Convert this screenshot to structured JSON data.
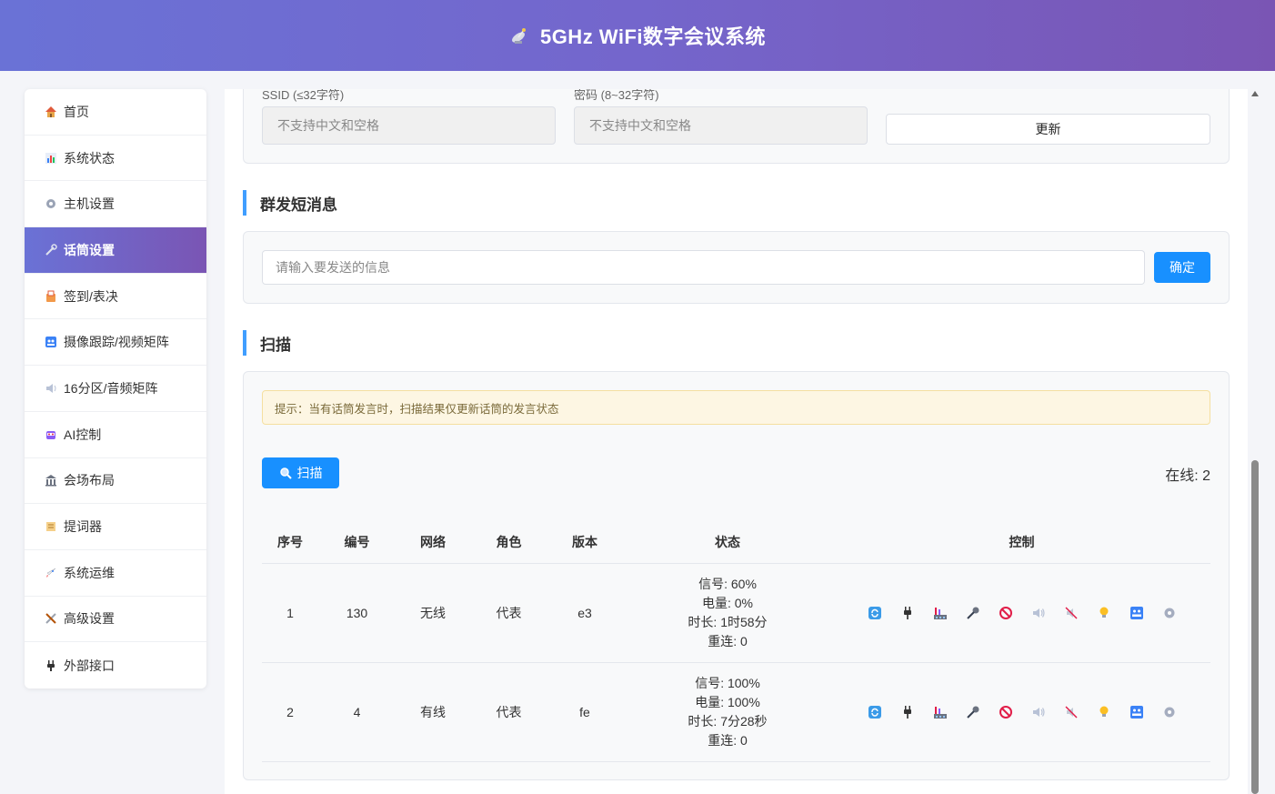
{
  "header": {
    "title": "5GHz WiFi数字会议系统",
    "logo_icon": "satellite-antenna-icon"
  },
  "sidebar": {
    "items": [
      {
        "label": "首页",
        "icon": "home-icon",
        "active": false
      },
      {
        "label": "系统状态",
        "icon": "bar-chart-icon",
        "active": false
      },
      {
        "label": "主机设置",
        "icon": "gear-icon",
        "active": false
      },
      {
        "label": "话筒设置",
        "icon": "wrench-icon",
        "active": true
      },
      {
        "label": "签到/表决",
        "icon": "ballot-icon",
        "active": false
      },
      {
        "label": "摄像跟踪/视频矩阵",
        "icon": "camera-icon",
        "active": false
      },
      {
        "label": "16分区/音频矩阵",
        "icon": "speaker-icon",
        "active": false
      },
      {
        "label": "AI控制",
        "icon": "robot-icon",
        "active": false
      },
      {
        "label": "会场布局",
        "icon": "building-icon",
        "active": false
      },
      {
        "label": "提词器",
        "icon": "scroll-icon",
        "active": false
      },
      {
        "label": "系统运维",
        "icon": "rocket-icon",
        "active": false
      },
      {
        "label": "高级设置",
        "icon": "tools-icon",
        "active": false
      },
      {
        "label": "外部接口",
        "icon": "plug-icon",
        "active": false
      }
    ]
  },
  "wifi": {
    "ssid_label": "SSID (≤32字符)",
    "ssid_placeholder": "不支持中文和空格",
    "password_label": "密码 (8~32字符)",
    "password_placeholder": "不支持中文和空格",
    "update_label": "更新"
  },
  "broadcast": {
    "title": "群发短消息",
    "placeholder": "请输入要发送的信息",
    "confirm_label": "确定"
  },
  "scan": {
    "title": "扫描",
    "notice": "提示：当有话筒发言时，扫描结果仅更新话筒的发言状态",
    "scan_label": "扫描",
    "online_label": "在线: 2",
    "columns": [
      "序号",
      "编号",
      "网络",
      "角色",
      "版本",
      "状态",
      "控制"
    ],
    "rows": [
      {
        "index": "1",
        "id": "130",
        "network": "无线",
        "role": "代表",
        "version": "e3",
        "signal": "信号: 60%",
        "battery": "电量: 0%",
        "duration": "时长: 1时58分",
        "reconnect": "重连: 0"
      },
      {
        "index": "2",
        "id": "4",
        "network": "有线",
        "role": "代表",
        "version": "fe",
        "signal": "信号: 100%",
        "battery": "电量: 100%",
        "duration": "时长: 7分28秒",
        "reconnect": "重连: 0"
      }
    ],
    "control_icons": [
      "refresh-icon",
      "plug-icon",
      "factory-icon",
      "microphone-icon",
      "prohibited-icon",
      "speaker-icon",
      "mute-icon",
      "lightbulb-icon",
      "camera-icon",
      "gear-icon"
    ]
  }
}
